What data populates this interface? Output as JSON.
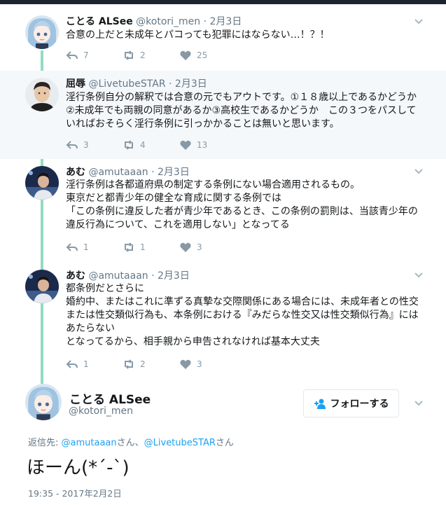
{
  "tweets": [
    {
      "name": "ことる ALSee",
      "handle": "@kotori_men",
      "dot": "·",
      "time": "2月3日",
      "lines": [
        "合意の上だと未成年とパコっても犯罪にはならない…！？！"
      ],
      "replies": "7",
      "retweets": "2",
      "likes": "25",
      "avatar_icon": "anime-girl-avatar-icon"
    },
    {
      "name": "屈辱",
      "handle": "@LivetubeSTAR",
      "dot": "·",
      "time": "2月3日",
      "lines": [
        "淫行条例自分の解釈では合意の元でもアウトです。①１８歳以上であるかどうか",
        "②未成年でも両親の同意があるか③高校生であるかどうか　この３つをパスして",
        "いればおそらく淫行条例に引っかかることは無いと思います。"
      ],
      "replies": "3",
      "retweets": "4",
      "likes": "13",
      "avatar_icon": "man-photo-avatar-icon"
    },
    {
      "name": "あむ",
      "handle": "@amutaaan",
      "dot": "·",
      "time": "2月3日",
      "lines": [
        "淫行条例は各都道府県の制定する条例にない場合適用されるもの。",
        "東京だと都青少年の健全な育成に関する条例では",
        "「この条例に違反した者が青少年であるとき、この条例の罰則は、当該青少年の",
        "違反行為について、これを適用しない」となってる"
      ],
      "replies": "1",
      "retweets": "1",
      "likes": "3",
      "avatar_icon": "person-photo-avatar-icon"
    },
    {
      "name": "あむ",
      "handle": "@amutaaan",
      "dot": "·",
      "time": "2月3日",
      "lines": [
        "都条例だとさらに",
        "婚約中、またはこれに準ずる真摯な交際関係にある場合には、未成年者との性交",
        "または性交類似行為も、本条例における『みだらな性交又は性交類似行為』には",
        "あたらない",
        "となってるから、相手親から申告されなければ基本大丈夫"
      ],
      "replies": "1",
      "retweets": "2",
      "likes": "3",
      "avatar_icon": "person-photo-avatar-icon"
    }
  ],
  "main": {
    "name": "ことる ALSee",
    "handle": "@kotori_men",
    "follow_label": "フォローする",
    "reply_prefix": "返信先: ",
    "reply_user1": "@amutaaan",
    "reply_san1": "さん、",
    "reply_user2": "@LivetubeSTAR",
    "reply_san2": "さん",
    "text": "ほーん(*´-`)",
    "timestamp": "19:35 - 2017年2月2日"
  },
  "colors": {
    "thread_line": "#93dcc1",
    "link": "#1da1f2",
    "muted": "#657786",
    "highlight_bg": "#f5f8fa"
  }
}
